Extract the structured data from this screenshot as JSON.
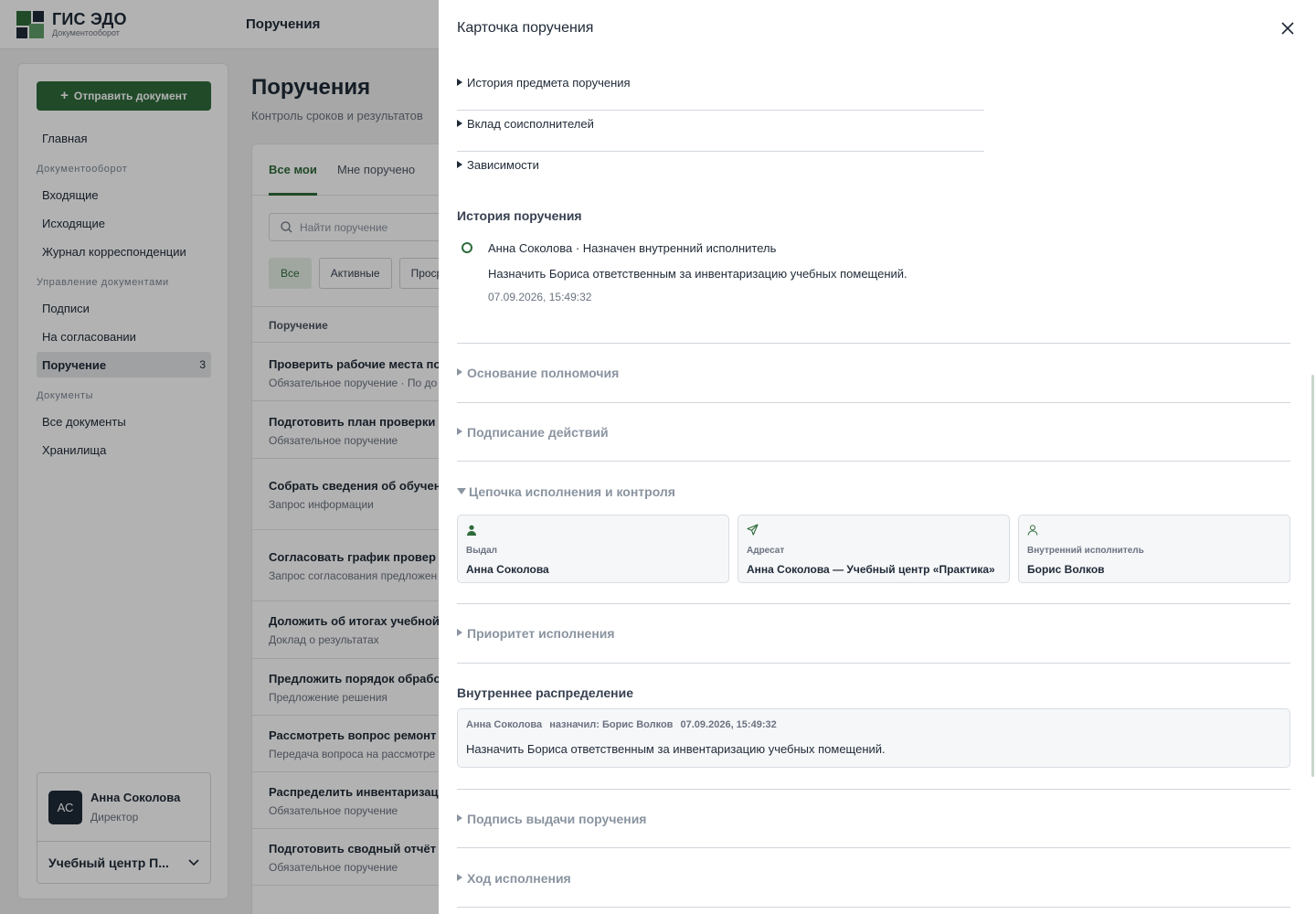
{
  "app": {
    "name": "ГИС ЭДО",
    "subtitle": "Документооборот",
    "page_title": "Поручения"
  },
  "sidebar": {
    "send_button": "Отправить документ",
    "home": "Главная",
    "sections": [
      {
        "title": "Документооборот",
        "items": [
          "Входящие",
          "Исходящие",
          "Журнал корреспонденции"
        ]
      },
      {
        "title": "Управление документами",
        "items": [
          "Подписи",
          "На согласовании"
        ]
      },
      {
        "title": "Документы",
        "items": [
          "Все документы",
          "Хранилища"
        ]
      }
    ],
    "active_item": {
      "label": "Поручение",
      "count": "3"
    },
    "user": {
      "initials": "АС",
      "name": "Анна Соколова",
      "role": "Директор",
      "org": "Учебный центр П..."
    }
  },
  "main": {
    "title": "Поручения",
    "subtitle": "Контроль сроков и результатов",
    "tabs": [
      "Все мои",
      "Мне поручено"
    ],
    "search_placeholder": "Найти поручение",
    "filters": [
      "Все",
      "Активные",
      "Проср"
    ],
    "column_header": "Поручение",
    "rows": [
      {
        "title": "Проверить рабочие места по",
        "sub": "Обязательное поручение · По до"
      },
      {
        "title": "Подготовить план проверки",
        "sub": "Обязательное поручение"
      },
      {
        "title": "Собрать сведения об обучен",
        "sub": "Запрос информации"
      },
      {
        "title": "Согласовать график провер",
        "sub": "Запрос согласования предложен"
      },
      {
        "title": "Доложить об итогах учебной",
        "sub": "Доклад о результатах"
      },
      {
        "title": "Предложить порядок обрабо",
        "sub": "Предложение решения"
      },
      {
        "title": "Рассмотреть вопрос ремонт",
        "sub": "Передача вопроса на рассмотре"
      },
      {
        "title": "Распределить инвентаризац",
        "sub": "Обязательное поручение"
      },
      {
        "title": "Подготовить сводный отчёт",
        "sub": "Обязательное поручение"
      }
    ]
  },
  "drawer": {
    "title": "Карточка поручения",
    "details": [
      "История предмета поручения",
      "Вклад соисполнителей",
      "Зависимости"
    ],
    "history": {
      "title": "История поручения",
      "head": "Анна Соколова · Назначен внутренний исполнитель",
      "text": "Назначить Бориса ответственным за инвентаризацию учебных помещений.",
      "time": "07.09.2026, 15:49:32"
    },
    "accordions": {
      "authority": "Основание полномочия",
      "signing": "Подписание действий",
      "chain": "Цепочка исполнения и контроля",
      "priority": "Приоритет исполнения",
      "issue_signature": "Подпись выдачи поручения",
      "progress": "Ход исполнения"
    },
    "chain": [
      {
        "label": "Выдал",
        "value": "Анна Соколова",
        "icon": "user-filled-icon"
      },
      {
        "label": "Адресат",
        "value": "Анна Соколова — Учебный центр «Практика»",
        "icon": "send-icon"
      },
      {
        "label": "Внутренний исполнитель",
        "value": "Борис Волков",
        "icon": "user-outline-icon"
      }
    ],
    "distribution": {
      "title": "Внутреннее распределение",
      "author": "Анна Соколова",
      "action": "назначил: Борис Волков",
      "time": "07.09.2026, 15:49:32",
      "text": "Назначить Бориса ответственным за инвентаризацию учебных помещений."
    }
  },
  "colors": {
    "accent": "#2e6b3a",
    "text": "#1f2a37",
    "muted": "#8a94a0"
  }
}
